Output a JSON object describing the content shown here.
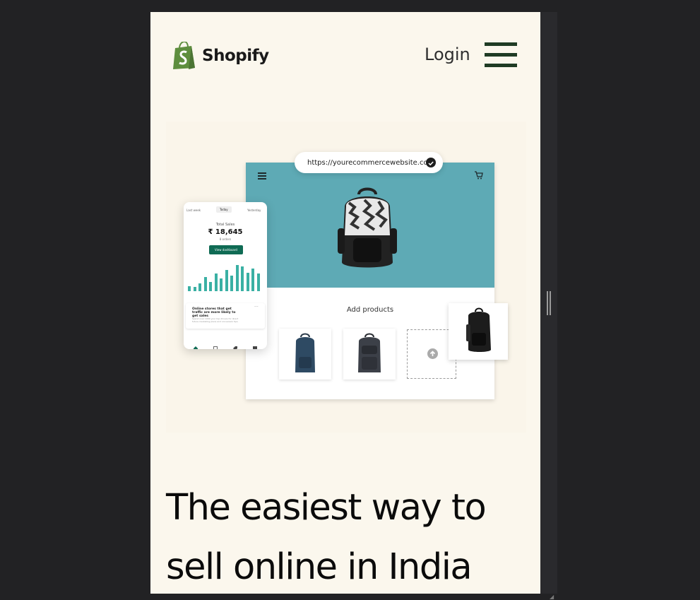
{
  "header": {
    "brand_name": "Shopify",
    "login_label": "Login",
    "logo_icon": "shopify-bag-icon",
    "menu_icon": "hamburger-menu-icon",
    "brand_color": "#5e8e3e",
    "menu_color": "#1f3b24"
  },
  "hero_illustration": {
    "url_bar": "https://yourecommercewebsite.com",
    "add_products_label": "Add products",
    "banner_color": "#5eaab5",
    "dashboard": {
      "tabs": [
        "Last week",
        "Today",
        "Yesterday"
      ],
      "total_label": "Total Sales",
      "total_value": "₹ 18,645",
      "orders_label": "8 orders",
      "button_label": "View dashboard",
      "accent_color": "#3ab0a4",
      "button_color": "#0f6b54",
      "bar_levels": [
        0.18,
        0.16,
        0.28,
        0.5,
        0.32,
        0.62,
        0.45,
        0.75,
        0.55,
        0.92,
        0.88,
        0.66,
        0.8,
        0.62
      ],
      "tip_title": "Online stores that get traffic are more likely to get sales",
      "tip_body": "Spend over 1000 your top drivers for direct future marketing plans and conversion tips"
    }
  },
  "headline": {
    "line1": "The easiest way to",
    "line2": "sell online in India"
  }
}
